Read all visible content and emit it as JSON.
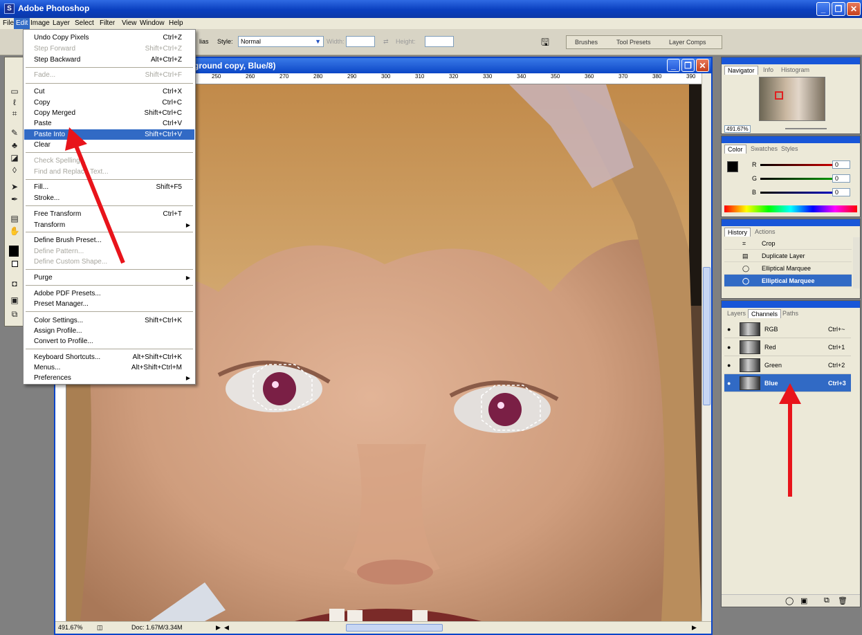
{
  "app": {
    "title": "Adobe Photoshop",
    "icon": "photoshop-icon",
    "icon_letter": "S"
  },
  "menubar": [
    "File",
    "Edit",
    "Image",
    "Layer",
    "Select",
    "Filter",
    "View",
    "Window",
    "Help"
  ],
  "options_bar": {
    "antialias_label": "lias",
    "style_label": "Style:",
    "style_value": "Normal",
    "width_label": "Width:",
    "height_label": "Height:",
    "palette_well": [
      "Brushes",
      "Tool Presets",
      "Layer Comps"
    ]
  },
  "document": {
    "title": "ground copy, Blue/8)",
    "ruler_ticks": [
      "250",
      "260",
      "270",
      "280",
      "290",
      "300",
      "310",
      "320",
      "330",
      "340",
      "350",
      "360",
      "370",
      "380",
      "390"
    ],
    "status_zoom": "491.67%",
    "status_doc": "Doc: 1.67M/3.34M"
  },
  "edit_menu": {
    "items": [
      {
        "label": "Undo Copy Pixels",
        "shortcut": "Ctrl+Z"
      },
      {
        "label": "Step Forward",
        "shortcut": "Shift+Ctrl+Z"
      },
      {
        "label": "Step Backward",
        "shortcut": "Alt+Ctrl+Z"
      },
      {
        "label": "Fade...",
        "shortcut": "Shift+Ctrl+F"
      },
      {
        "label": "Cut",
        "shortcut": "Ctrl+X"
      },
      {
        "label": "Copy",
        "shortcut": "Ctrl+C"
      },
      {
        "label": "Copy Merged",
        "shortcut": "Shift+Ctrl+C"
      },
      {
        "label": "Paste",
        "shortcut": "Ctrl+V"
      },
      {
        "label": "Paste Into",
        "shortcut": "Shift+Ctrl+V"
      },
      {
        "label": "Clear",
        "shortcut": ""
      },
      {
        "label": "Check Spelling...",
        "shortcut": ""
      },
      {
        "label": "Find and Replace Text...",
        "shortcut": ""
      },
      {
        "label": "Fill...",
        "shortcut": "Shift+F5"
      },
      {
        "label": "Stroke...",
        "shortcut": ""
      },
      {
        "label": "Free Transform",
        "shortcut": "Ctrl+T"
      },
      {
        "label": "Transform",
        "shortcut": ""
      },
      {
        "label": "Define Brush Preset...",
        "shortcut": ""
      },
      {
        "label": "Define Pattern...",
        "shortcut": ""
      },
      {
        "label": "Define Custom Shape...",
        "shortcut": ""
      },
      {
        "label": "Purge",
        "shortcut": ""
      },
      {
        "label": "Adobe PDF Presets...",
        "shortcut": ""
      },
      {
        "label": "Preset Manager...",
        "shortcut": ""
      },
      {
        "label": "Color Settings...",
        "shortcut": "Shift+Ctrl+K"
      },
      {
        "label": "Assign Profile...",
        "shortcut": ""
      },
      {
        "label": "Convert to Profile...",
        "shortcut": ""
      },
      {
        "label": "Keyboard Shortcuts...",
        "shortcut": "Alt+Shift+Ctrl+K"
      },
      {
        "label": "Menus...",
        "shortcut": "Alt+Shift+Ctrl+M"
      },
      {
        "label": "Preferences",
        "shortcut": ""
      }
    ]
  },
  "navigator": {
    "tabs": [
      "Navigator",
      "Info",
      "Histogram"
    ],
    "zoom": "491.67%"
  },
  "color": {
    "tabs": [
      "Color",
      "Swatches",
      "Styles"
    ],
    "channels": [
      {
        "name": "R",
        "value": "0",
        "color": "#d40000"
      },
      {
        "name": "G",
        "value": "0",
        "color": "#00a000"
      },
      {
        "name": "B",
        "value": "0",
        "color": "#0000c8"
      }
    ]
  },
  "history": {
    "tabs": [
      "History",
      "Actions"
    ],
    "items": [
      "Crop",
      "Duplicate Layer",
      "Elliptical Marquee",
      "Elliptical Marquee"
    ]
  },
  "channels": {
    "tabs": [
      "Layers",
      "Channels",
      "Paths"
    ],
    "items": [
      {
        "name": "RGB",
        "shortcut": "Ctrl+~"
      },
      {
        "name": "Red",
        "shortcut": "Ctrl+1"
      },
      {
        "name": "Green",
        "shortcut": "Ctrl+2"
      },
      {
        "name": "Blue",
        "shortcut": "Ctrl+3"
      }
    ]
  },
  "colors": {
    "titlebar": "#0a3fbf",
    "highlight": "#316ac5",
    "annotation_arrow": "#e8141b"
  }
}
